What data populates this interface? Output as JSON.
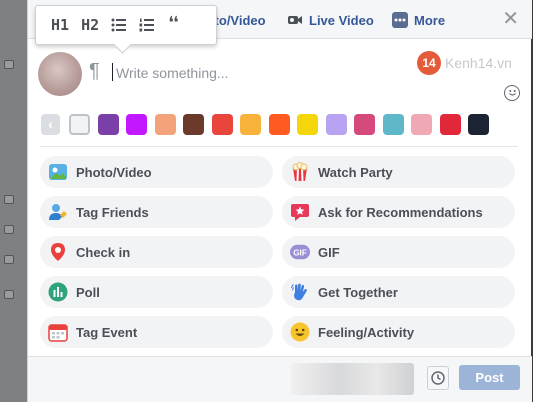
{
  "format_toolbar": {
    "h1": "H1",
    "h2": "H2",
    "quote_glyph": "❝",
    "icons": [
      "bulleted-list-icon",
      "numbered-list-icon",
      "quote-icon"
    ]
  },
  "tabs": [
    {
      "label": "Photo/Video",
      "icon": "photo-icon"
    },
    {
      "label": "Live Video",
      "icon": "video-camera-icon"
    },
    {
      "label": "More",
      "icon": "more-icon"
    }
  ],
  "close_glyph": "✕",
  "composer": {
    "pilcrow": "¶",
    "placeholder": "Write something..."
  },
  "watermark": {
    "logo": "14",
    "text": "Kenh14.vn"
  },
  "background_picker": {
    "back_glyph": "‹",
    "swatch_colors": [
      "#f2f3f5",
      "#7b3fa8",
      "#c318ff",
      "#f4a27a",
      "#6b3a2a",
      "#e8453c",
      "#f7b23b",
      "#ff5a1f",
      "#f5d60a",
      "#b7a3f2",
      "#d44a7c",
      "#5fb8c9",
      "#f0a8b4",
      "#e0283a",
      "#1c2433"
    ]
  },
  "actions": [
    {
      "label": "Photo/Video",
      "icon": "photo-icon"
    },
    {
      "label": "Watch Party",
      "icon": "popcorn-icon"
    },
    {
      "label": "Tag Friends",
      "icon": "tag-friends-icon"
    },
    {
      "label": "Ask for Recommendations",
      "icon": "recommendation-star-icon"
    },
    {
      "label": "Check in",
      "icon": "location-pin-icon"
    },
    {
      "label": "GIF",
      "icon": "gif-icon"
    },
    {
      "label": "Poll",
      "icon": "poll-icon"
    },
    {
      "label": "Get Together",
      "icon": "waving-hand-icon"
    },
    {
      "label": "Tag Event",
      "icon": "calendar-icon"
    },
    {
      "label": "Feeling/Activity",
      "icon": "smiley-icon"
    }
  ],
  "footer": {
    "post_label": "Post"
  },
  "colors": {
    "link_blue": "#365899",
    "post_disabled": "#9cb4d8",
    "pill_bg": "#f2f3f5"
  }
}
